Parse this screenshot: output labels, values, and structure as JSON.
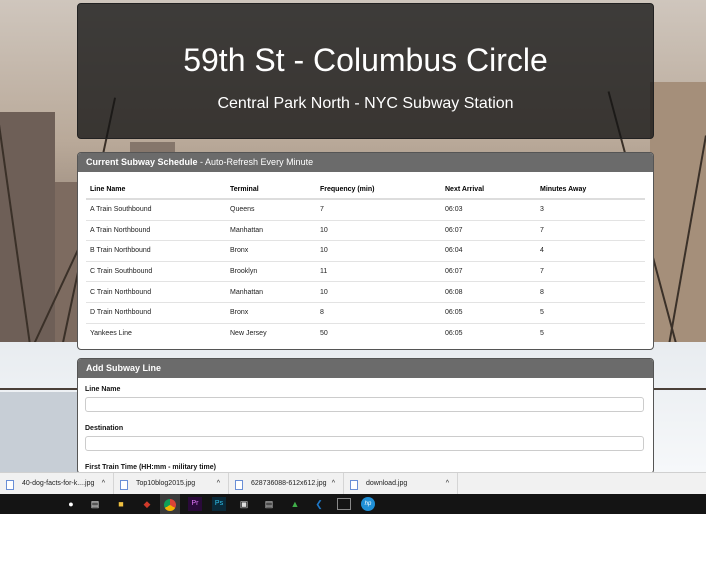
{
  "header": {
    "title": "59th St - Columbus Circle",
    "subtitle": "Central Park North - NYC Subway Station"
  },
  "schedule": {
    "heading_bold": "Current Subway Schedule",
    "heading_rest": " - Auto-Refresh Every Minute",
    "columns": [
      "Line Name",
      "Terminal",
      "Frequency (min)",
      "Next Arrival",
      "Minutes Away"
    ],
    "rows": [
      [
        "A Train Southbound",
        "Queens",
        "7",
        "06:03",
        "3"
      ],
      [
        "A Train Northbound",
        "Manhattan",
        "10",
        "06:07",
        "7"
      ],
      [
        "B Train Northbound",
        "Bronx",
        "10",
        "06:04",
        "4"
      ],
      [
        "C Train Southbound",
        "Brooklyn",
        "11",
        "06:07",
        "7"
      ],
      [
        "C Train Northbound",
        "Manhattan",
        "10",
        "06:08",
        "8"
      ],
      [
        "D Train Northbound",
        "Bronx",
        "8",
        "06:05",
        "5"
      ],
      [
        "Yankees Line",
        "New Jersey",
        "50",
        "06:05",
        "5"
      ]
    ]
  },
  "add_form": {
    "heading": "Add Subway Line",
    "line_name_label": "Line Name",
    "line_name_value": "",
    "destination_label": "Destination",
    "destination_value": "",
    "first_train_label": "First Train Time (HH:mm - military time)"
  },
  "downloads": [
    {
      "name": "40-dog-facts-for-k....jpg"
    },
    {
      "name": "Top10blog2015.jpg"
    },
    {
      "name": "628736088-612x612.jpg"
    },
    {
      "name": "download.jpg"
    }
  ],
  "taskbar": {
    "icons": [
      "microphone-icon",
      "task-view-icon",
      "file-explorer-icon",
      "app-red-icon",
      "chrome-icon",
      "premiere-icon",
      "photoshop-icon",
      "store-icon",
      "notes-icon",
      "app-green-icon",
      "vscode-icon",
      "terminal-icon",
      "hp-icon"
    ],
    "colors": {
      "premiere": "#2a0a3a",
      "photoshop": "#0a2a3a",
      "vscode": "#1e78c8",
      "hp": "#1f8fd6"
    }
  }
}
